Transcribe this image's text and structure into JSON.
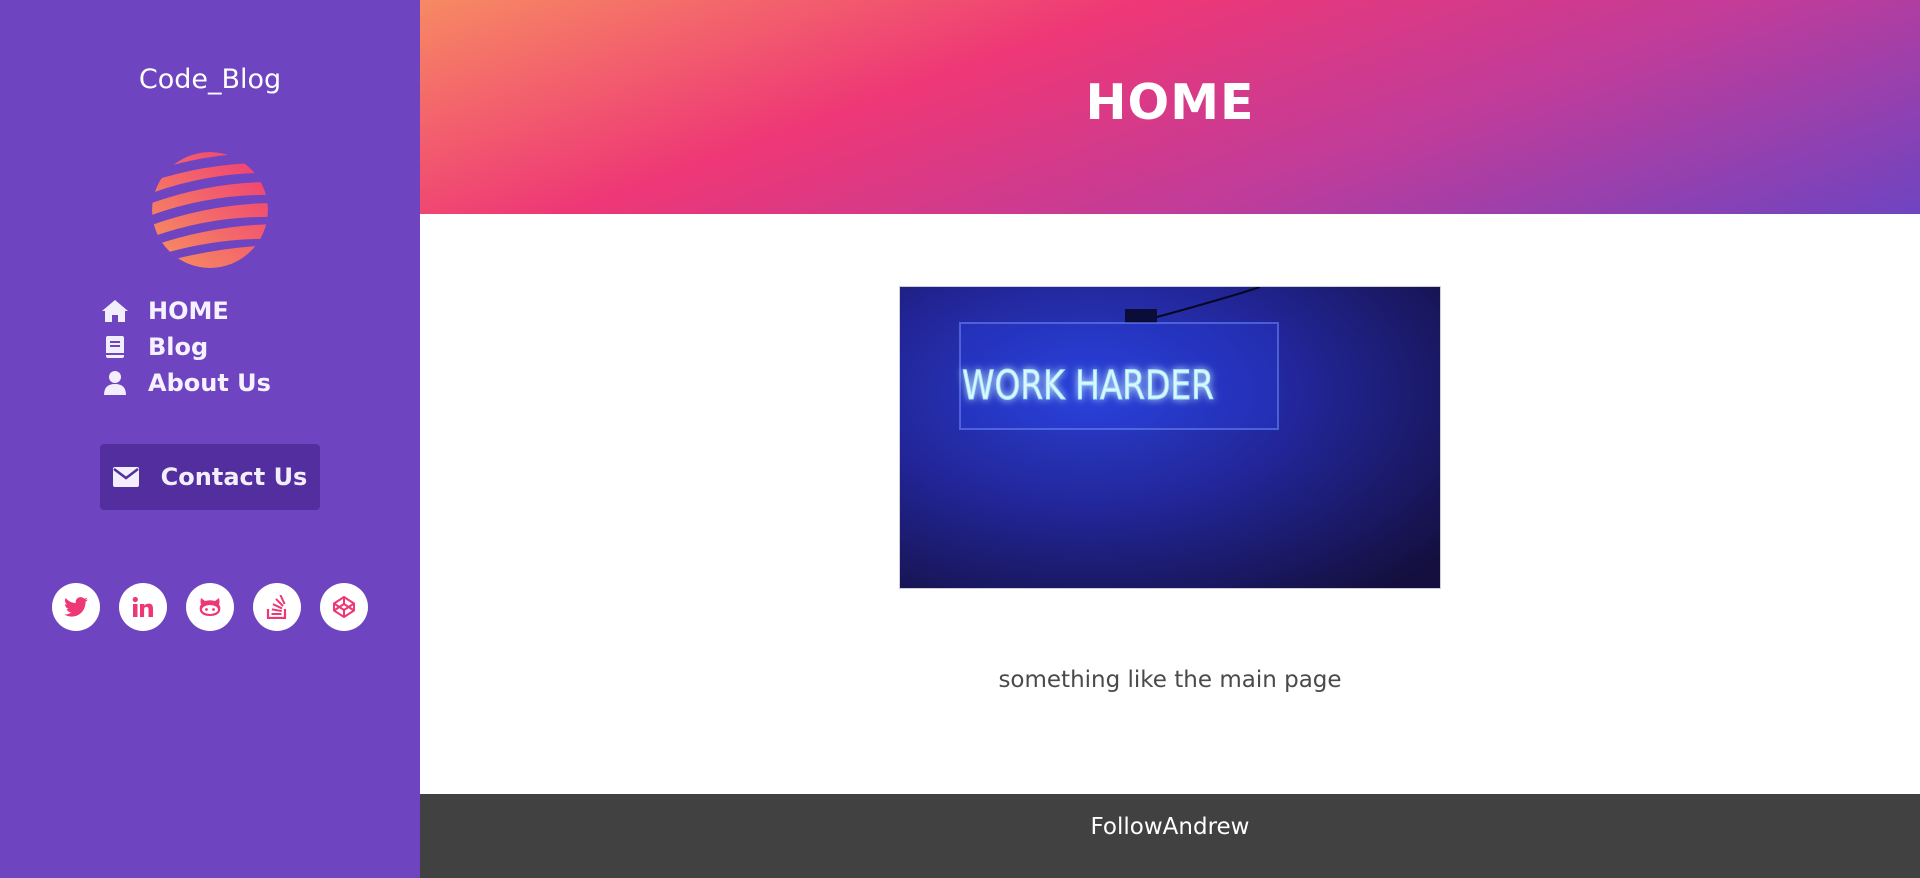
{
  "sidebar": {
    "brand": "Code_Blog",
    "logo_icon": "globe-logo-icon",
    "nav": [
      {
        "label": "HOME",
        "icon": "home-icon"
      },
      {
        "label": "Blog",
        "icon": "book-icon"
      },
      {
        "label": "About Us",
        "icon": "user-icon"
      }
    ],
    "contact_label": "Contact Us",
    "contact_icon": "envelope-icon",
    "socials": [
      "twitter-icon",
      "linkedin-icon",
      "github-icon",
      "stackoverflow-icon",
      "codepen-icon"
    ]
  },
  "header": {
    "title": "HOME"
  },
  "main": {
    "hero_text": "WORK HARDER",
    "caption": "something like the main page"
  },
  "footer": {
    "text": "FollowAndrew"
  },
  "colors": {
    "sidebar_bg": "#6e44c1",
    "button_bg": "#522e9e",
    "accent": "#ee3776",
    "footer_bg": "#414141"
  }
}
